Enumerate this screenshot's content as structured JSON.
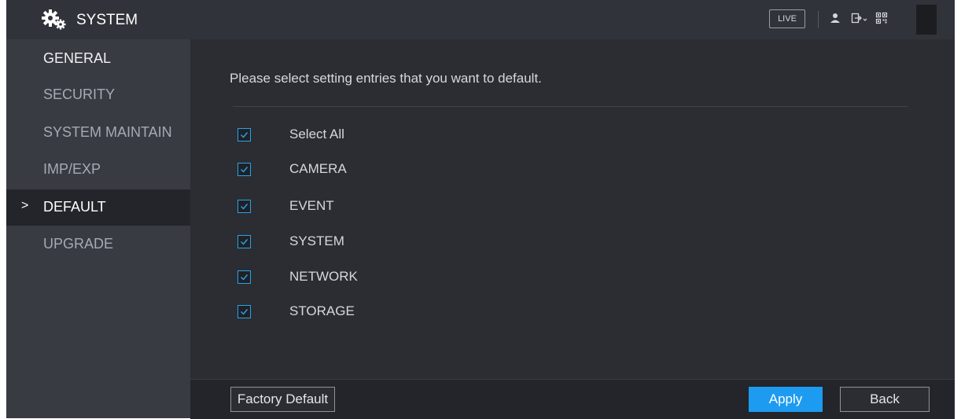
{
  "titlebar": {
    "title": "SYSTEM",
    "live_label": "LIVE",
    "icons": [
      "gear-icon",
      "user-icon",
      "logout-icon",
      "qr-code-icon"
    ]
  },
  "sidebar": {
    "items": [
      {
        "label": "GENERAL"
      },
      {
        "label": "SECURITY"
      },
      {
        "label": "SYSTEM MAINTAIN"
      },
      {
        "label": "IMP/EXP"
      },
      {
        "label": "DEFAULT",
        "chevron": ">",
        "active": true
      },
      {
        "label": "UPGRADE"
      }
    ]
  },
  "main": {
    "instruction": "Please select setting entries that you want to default.",
    "options": [
      {
        "label": "Select All",
        "checked": true
      },
      {
        "label": "CAMERA",
        "checked": true
      },
      {
        "label": "EVENT",
        "checked": true
      },
      {
        "label": "SYSTEM",
        "checked": true
      },
      {
        "label": "NETWORK",
        "checked": true
      },
      {
        "label": "STORAGE",
        "checked": true
      }
    ]
  },
  "footer": {
    "factory_default_label": "Factory Default",
    "apply_label": "Apply",
    "back_label": "Back"
  },
  "colors": {
    "accent": "#1d9bf0",
    "checkbox_border": "#29a3e6",
    "background": "#2b2d33",
    "sidebar": "#393b42"
  }
}
